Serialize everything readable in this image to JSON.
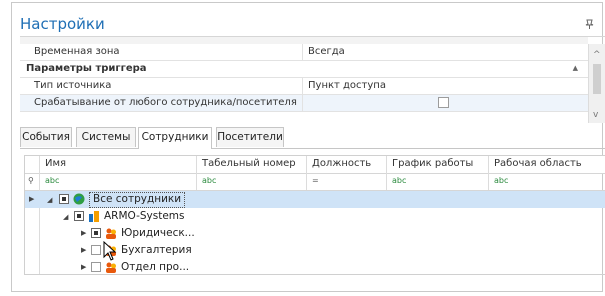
{
  "panel": {
    "title": "Настройки",
    "pin_icon": "pin-icon"
  },
  "property_grid": {
    "rows": [
      {
        "key": "Временная зона",
        "value": "Всегда"
      }
    ],
    "category": {
      "label": "Параметры триггера"
    },
    "trigger_rows": [
      {
        "key": "Тип источника",
        "value": "Пункт доступа"
      },
      {
        "key": "Срабатывание от любого сотрудника/посетителя",
        "value": ""
      }
    ]
  },
  "tabs": [
    {
      "label": "События"
    },
    {
      "label": "Системы"
    },
    {
      "label": "Сотрудники",
      "active": true
    },
    {
      "label": "Посетители"
    }
  ],
  "grid": {
    "columns": [
      "Имя",
      "Табельный номер",
      "Должность",
      "График работы",
      "Рабочая область"
    ],
    "filter_row": [
      "abc",
      "abc",
      "=",
      "abc",
      "abc"
    ],
    "rows": [
      {
        "label": "Все сотрудники",
        "level": 0,
        "checked": "indeterminate",
        "icon": "globe-icon",
        "selected": true
      },
      {
        "label": "ARMO-Systems",
        "level": 1,
        "checked": "indeterminate",
        "icon": "company-icon"
      },
      {
        "label": "Юридическ...",
        "level": 2,
        "checked": "indeterminate",
        "icon": "department-icon"
      },
      {
        "label": "Бухгалтерия",
        "level": 2,
        "checked": "unchecked",
        "icon": "department-icon"
      },
      {
        "label": "Отдел про...",
        "level": 2,
        "checked": "unchecked",
        "icon": "department-icon"
      }
    ]
  },
  "colors": {
    "accent": "#1f6fb5",
    "selection": "#cfe3f7"
  }
}
